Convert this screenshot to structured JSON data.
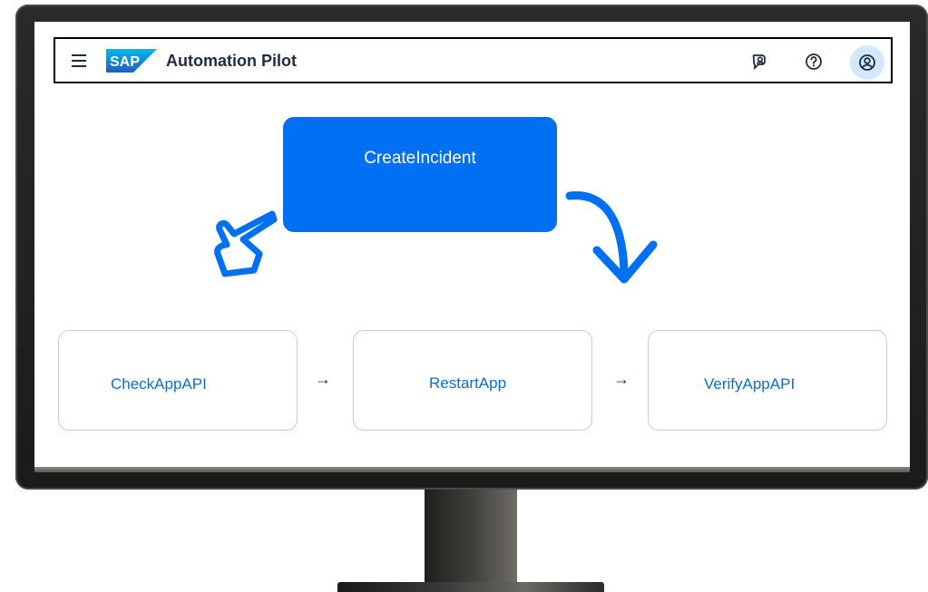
{
  "app": {
    "brand": "SAP",
    "title": "Automation Pilot"
  },
  "shellbar": {
    "icons": [
      "menu-icon",
      "sap-logo",
      "chat-feedback-icon",
      "help-icon",
      "user-avatar-icon"
    ]
  },
  "workflow": {
    "trigger": {
      "label": "CreateIncident"
    },
    "steps": [
      {
        "label": "CheckAppAPI"
      },
      {
        "label": "RestartApp"
      },
      {
        "label": "VerifyAppAPI"
      }
    ],
    "connector": "→"
  },
  "colors": {
    "accent": "#0070f2",
    "link_text": "#0a6ed1",
    "avatar_bg": "#d1e8ff",
    "text_dark": "#1d2d3e"
  }
}
